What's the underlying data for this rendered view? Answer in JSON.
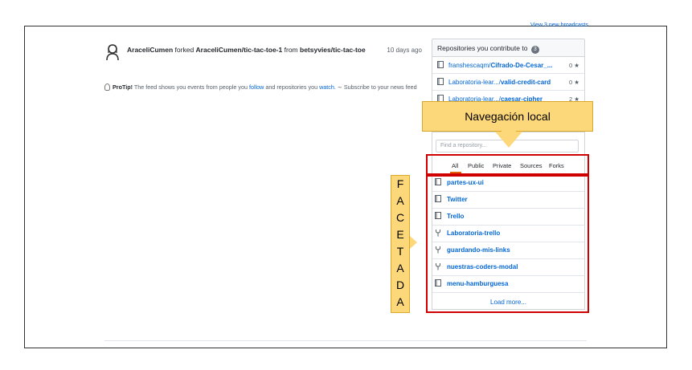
{
  "header": {
    "broadcasts_link": "View 3 new broadcasts"
  },
  "feed": {
    "actor": "AraceliCumen",
    "action": "forked",
    "target": "AraceliCumen/tic-tac-toe-1",
    "from_word": "from",
    "source": "betsyvies/tic-tac-toe",
    "time": "10 days ago"
  },
  "protip": {
    "label": "ProTip!",
    "text1": "The feed shows you events from people you",
    "follow": "follow",
    "text2": "and repositories you",
    "watch": "watch.",
    "subscribe": "Subscribe to your news feed"
  },
  "contribute": {
    "title": "Repositories you contribute to",
    "count": "3",
    "items": [
      {
        "owner": "franshescaqm/",
        "name": "Cifrado-De-Cesar_...",
        "stars": "0"
      },
      {
        "owner": "Laboratoria-lear.../",
        "name": "valid-credit-card",
        "stars": "0"
      },
      {
        "owner": "Laboratoria-lear.../",
        "name": "caesar-cipher",
        "stars": "2"
      }
    ]
  },
  "callout_top": "Navegación local",
  "find_placeholder": "Find a repository...",
  "filters": [
    "All",
    "Public",
    "Private",
    "Sources",
    "Forks"
  ],
  "repos": [
    {
      "name": "partes-ux-ui",
      "type": "repo"
    },
    {
      "name": "Twitter",
      "type": "repo"
    },
    {
      "name": "Trello",
      "type": "repo"
    },
    {
      "name": "Laboratoria-trello",
      "type": "fork"
    },
    {
      "name": "guardando-mis-links",
      "type": "fork"
    },
    {
      "name": "nuestras-coders-modal",
      "type": "fork"
    },
    {
      "name": "menu-hamburguesa",
      "type": "repo"
    }
  ],
  "load_more": "Load more...",
  "side_letters": [
    "F",
    "A",
    "C",
    "E",
    "T",
    "A",
    "D",
    "A"
  ],
  "colors": {
    "link": "#0366d6",
    "callout": "#fdd87a",
    "highlight": "#d00000",
    "tab_active": "#e36209"
  }
}
